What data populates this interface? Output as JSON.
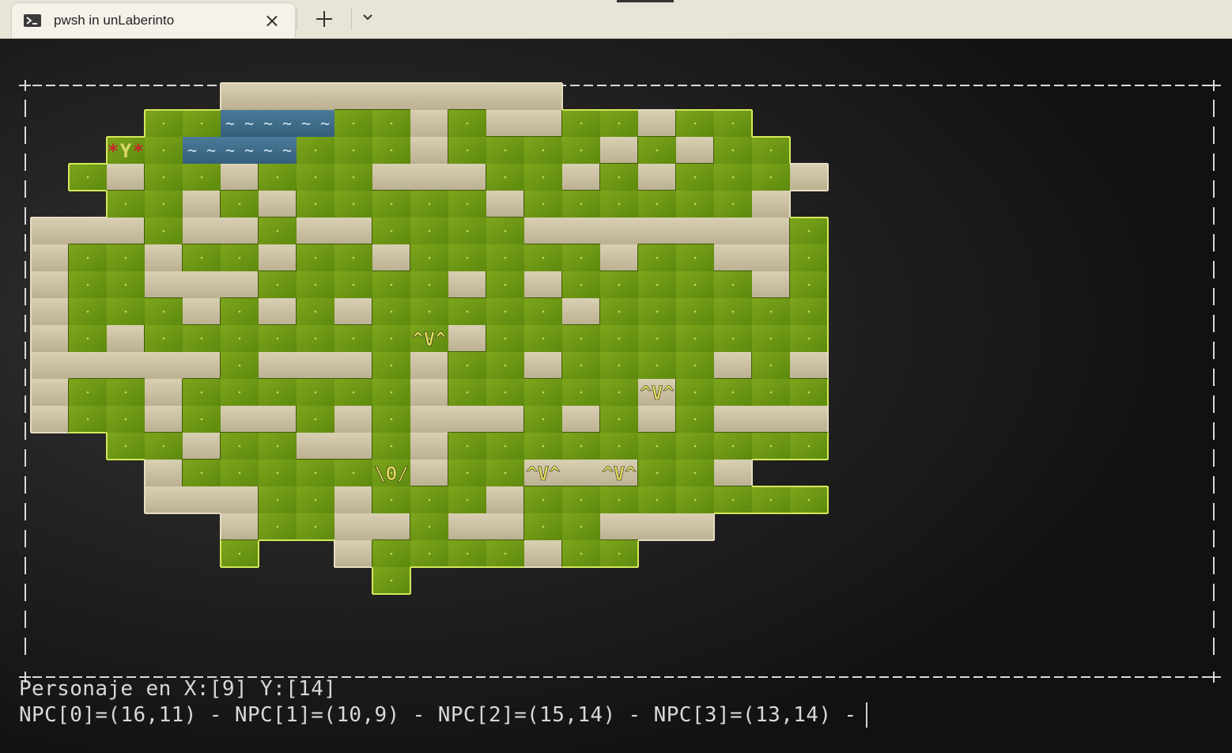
{
  "window": {
    "tab_title": "pwsh in unLaberinto",
    "tab_icon": "terminal-icon",
    "new_tab_icon": "plus-icon",
    "dropdown_icon": "chevron-down-icon",
    "close_icon": "close-icon"
  },
  "colors": {
    "grass": "#6f9a14",
    "grass_edge": "#d4e85a",
    "wall": "#cbbf9f",
    "water": "#3f6f8f",
    "sprite": "#e6e05a",
    "star": "#c0282a",
    "border": "#d9d9d9"
  },
  "game": {
    "legend": {
      "#": "wall",
      ".": "grass",
      "~": "water",
      " ": "empty"
    },
    "map": [
      "     #########       ",
      "   ..~~~..#.##..#..  ",
      "  ..~~~...#....#.#.. ",
      " .#..#...###..#.#...#",
      "  ..#.#.....#......# ",
      "###.##.##....#######.",
      "#..#..#..#.....#..##.",
      "#..###.....#.#.....#.",
      "#...#.#.#.....#......",
      "#.#........#.........",
      "#####.###.#..#....#.#",
      "#..#......#.....#....",
      "#..#.##.#.###.#.#.###",
      "  ..#..##.#..........",
      "   #......#..###..#  ",
      "   ###..#...#........",
      "     #..##.##..###   ",
      "     .  #....#..     ",
      "         .           "
    ],
    "character": {
      "glyph": "\\O/",
      "x": 9,
      "y": 14
    },
    "npc_glyph": "^V^",
    "npcs": [
      {
        "x": 16,
        "y": 11
      },
      {
        "x": 10,
        "y": 9
      },
      {
        "x": 15,
        "y": 14
      },
      {
        "x": 13,
        "y": 14
      }
    ],
    "flower": {
      "glyph": "Y",
      "stars": "*"
    }
  },
  "status": {
    "line1": "Personaje en X:[9] Y:[14]",
    "line2": "NPC[0]=(16,11) - NPC[1]=(10,9) - NPC[2]=(15,14) - NPC[3]=(13,14) - "
  }
}
